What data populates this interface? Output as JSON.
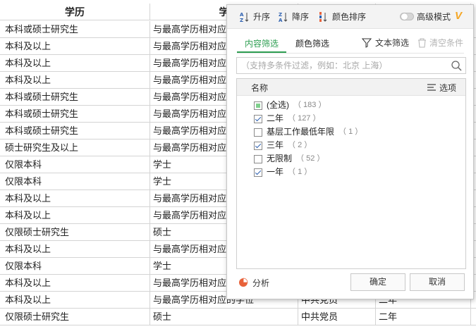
{
  "sheet": {
    "headers": [
      "学历",
      "学",
      "",
      "",
      ""
    ],
    "rows": [
      [
        "本科或硕士研究生",
        "与最高学历相对应",
        "",
        "",
        ""
      ],
      [
        "本科及以上",
        "与最高学历相对应",
        "",
        "",
        ""
      ],
      [
        "本科及以上",
        "与最高学历相对应",
        "",
        "",
        ""
      ],
      [
        "本科及以上",
        "与最高学历相对应",
        "",
        "",
        ""
      ],
      [
        "本科或硕士研究生",
        "与最高学历相对应",
        "",
        "",
        ""
      ],
      [
        "本科或硕士研究生",
        "与最高学历相对应",
        "",
        "",
        ""
      ],
      [
        "本科或硕士研究生",
        "与最高学历相对应",
        "",
        "",
        ""
      ],
      [
        "硕士研究生及以上",
        "与最高学历相对应",
        "",
        "",
        ""
      ],
      [
        "仅限本科",
        "学士",
        "",
        "",
        ""
      ],
      [
        "仅限本科",
        "学士",
        "",
        "",
        ""
      ],
      [
        "本科及以上",
        "与最高学历相对应",
        "",
        "",
        ""
      ],
      [
        "本科及以上",
        "与最高学历相对应",
        "",
        "",
        ""
      ],
      [
        "仅限硕士研究生",
        "硕士",
        "",
        "",
        ""
      ],
      [
        "本科及以上",
        "与最高学历相对应",
        "",
        "",
        ""
      ],
      [
        "仅限本科",
        "学士",
        "",
        "",
        ""
      ],
      [
        "本科及以上",
        "与最高学历相对应",
        "",
        "",
        ""
      ],
      [
        "本科及以上",
        "与最高学历相对应的学位",
        "中共党员",
        "二年",
        ""
      ],
      [
        "仅限硕士研究生",
        "硕士",
        "中共党员",
        "二年",
        ""
      ]
    ]
  },
  "popup": {
    "toolbar": {
      "asc_label": "升序",
      "desc_label": "降序",
      "color_sort_label": "颜色排序",
      "advanced_label": "高级模式",
      "vip_badge": "V"
    },
    "tabs": {
      "content_label": "内容筛选",
      "color_label": "颜色筛选",
      "text_filter_label": "文本筛选",
      "clear_label": "清空条件"
    },
    "search": {
      "placeholder": "（支持多条件过滤，例如：北京 上海）"
    },
    "list": {
      "name_header": "名称",
      "options_label": "选项",
      "items": [
        {
          "label": "(全选)",
          "count": "（ 183 ）",
          "state": "partial"
        },
        {
          "label": "二年",
          "count": "（ 127 ）",
          "state": "checked"
        },
        {
          "label": "基层工作最低年限",
          "count": "（ 1 ）",
          "state": "unchecked"
        },
        {
          "label": "三年",
          "count": "（ 2 ）",
          "state": "checked"
        },
        {
          "label": "无限制",
          "count": "（ 52 ）",
          "state": "unchecked"
        },
        {
          "label": "一年",
          "count": "（ 1 ）",
          "state": "checked"
        }
      ]
    },
    "footer": {
      "analyze_label": "分析",
      "ok_label": "确定",
      "cancel_label": "取消"
    },
    "colors": {
      "accent": "#2e9e52",
      "vip": "#f5a623",
      "analyze": "#e8623a"
    }
  }
}
